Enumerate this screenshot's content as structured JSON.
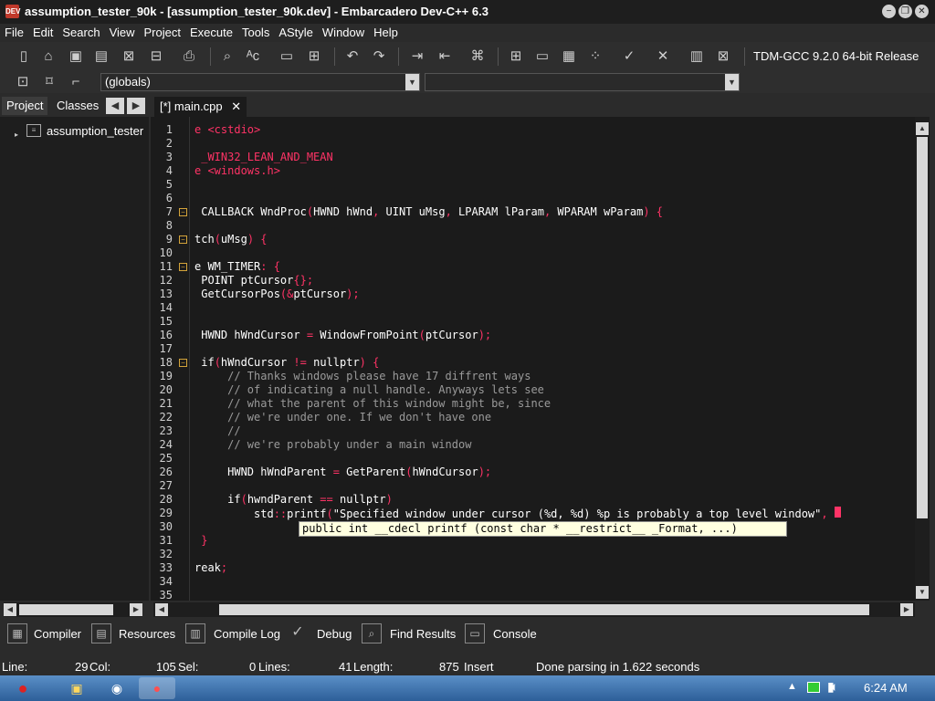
{
  "window": {
    "title": "assumption_tester_90k - [assumption_tester_90k.dev] - Embarcadero Dev-C++ 6.3",
    "app_icon_text": "DEV"
  },
  "menu": [
    "File",
    "Edit",
    "Search",
    "View",
    "Project",
    "Execute",
    "Tools",
    "AStyle",
    "Window",
    "Help"
  ],
  "toolbar": {
    "compiler_label": "TDM-GCC 9.2.0 64-bit Release",
    "scope_value": "(globals)"
  },
  "left_panel": {
    "tabs": [
      "Project",
      "Classes"
    ],
    "tree_item": "assumption_tester"
  },
  "editor": {
    "tab_label": "[*] main.cpp",
    "lines": [
      {
        "n": "1",
        "segs": [
          [
            "pp",
            "e <cstdio>"
          ]
        ]
      },
      {
        "n": "2",
        "segs": []
      },
      {
        "n": "3",
        "segs": [
          [
            "pp",
            " _WIN32_LEAN_AND_MEAN"
          ]
        ]
      },
      {
        "n": "4",
        "segs": [
          [
            "pp",
            "e <windows.h>"
          ]
        ]
      },
      {
        "n": "5",
        "segs": []
      },
      {
        "n": "6",
        "segs": []
      },
      {
        "n": "7",
        "segs": [
          [
            "kw",
            " CALLBACK WndProc"
          ],
          [
            "sym",
            "("
          ],
          [
            "kw",
            "HWND hWnd"
          ],
          [
            "sym",
            ", "
          ],
          [
            "kw",
            "UINT uMsg"
          ],
          [
            "sym",
            ", "
          ],
          [
            "kw",
            "LPARAM lParam"
          ],
          [
            "sym",
            ", "
          ],
          [
            "kw",
            "WPARAM wParam"
          ],
          [
            "sym",
            ") {"
          ]
        ]
      },
      {
        "n": "8",
        "segs": []
      },
      {
        "n": "9",
        "segs": [
          [
            "kw",
            "tch"
          ],
          [
            "sym",
            "("
          ],
          [
            "kw",
            "uMsg"
          ],
          [
            "sym",
            ") {"
          ]
        ]
      },
      {
        "n": "10",
        "segs": []
      },
      {
        "n": "11",
        "segs": [
          [
            "kw",
            "e WM_TIMER"
          ],
          [
            "sym",
            ": {"
          ]
        ]
      },
      {
        "n": "12",
        "segs": [
          [
            "kw",
            " POINT ptCursor"
          ],
          [
            "sym",
            "{};"
          ]
        ]
      },
      {
        "n": "13",
        "segs": [
          [
            "kw",
            " GetCursorPos"
          ],
          [
            "sym",
            "(&"
          ],
          [
            "kw",
            "ptCursor"
          ],
          [
            "sym",
            ");"
          ]
        ]
      },
      {
        "n": "14",
        "segs": []
      },
      {
        "n": "15",
        "segs": []
      },
      {
        "n": "16",
        "segs": [
          [
            "kw",
            " HWND hWndCursor "
          ],
          [
            "sym",
            "= "
          ],
          [
            "kw",
            "WindowFromPoint"
          ],
          [
            "sym",
            "("
          ],
          [
            "kw",
            "ptCursor"
          ],
          [
            "sym",
            ");"
          ]
        ]
      },
      {
        "n": "17",
        "segs": []
      },
      {
        "n": "18",
        "segs": [
          [
            "kw",
            " if"
          ],
          [
            "sym",
            "("
          ],
          [
            "kw",
            "hWndCursor "
          ],
          [
            "sym",
            "!= "
          ],
          [
            "kw",
            "nullptr"
          ],
          [
            "sym",
            ") {"
          ]
        ]
      },
      {
        "n": "19",
        "segs": [
          [
            "cm",
            "     // Thanks windows please have 17 diffrent ways"
          ]
        ]
      },
      {
        "n": "20",
        "segs": [
          [
            "cm",
            "     // of indicating a null handle. Anyways lets see"
          ]
        ]
      },
      {
        "n": "21",
        "segs": [
          [
            "cm",
            "     // what the parent of this window might be, since"
          ]
        ]
      },
      {
        "n": "22",
        "segs": [
          [
            "cm",
            "     // we're under one. If we don't have one"
          ]
        ]
      },
      {
        "n": "23",
        "segs": [
          [
            "cm",
            "     //"
          ]
        ]
      },
      {
        "n": "24",
        "segs": [
          [
            "cm",
            "     // we're probably under a main window"
          ]
        ]
      },
      {
        "n": "25",
        "segs": []
      },
      {
        "n": "26",
        "segs": [
          [
            "kw",
            "     HWND hWndParent "
          ],
          [
            "sym",
            "= "
          ],
          [
            "kw",
            "GetParent"
          ],
          [
            "sym",
            "("
          ],
          [
            "kw",
            "hWndCursor"
          ],
          [
            "sym",
            ");"
          ]
        ]
      },
      {
        "n": "27",
        "segs": []
      },
      {
        "n": "28",
        "segs": [
          [
            "kw",
            "     if"
          ],
          [
            "sym",
            "("
          ],
          [
            "kw",
            "hwndParent "
          ],
          [
            "sym",
            "== "
          ],
          [
            "kw",
            "nullptr"
          ],
          [
            "sym",
            ")"
          ]
        ]
      },
      {
        "n": "29",
        "segs": [
          [
            "kw",
            "         std"
          ],
          [
            "sym",
            "::"
          ],
          [
            "kw",
            "printf"
          ],
          [
            "sym",
            "("
          ],
          [
            "str",
            "\"Specified window under cursor (%d, %d) %p is probably a top level window\""
          ],
          [
            "sym",
            ", "
          ]
        ]
      },
      {
        "n": "30",
        "segs": []
      },
      {
        "n": "31",
        "segs": [
          [
            "sym",
            " }"
          ]
        ]
      },
      {
        "n": "32",
        "segs": []
      },
      {
        "n": "33",
        "segs": [
          [
            "kw",
            "reak"
          ],
          [
            "sym",
            ";"
          ]
        ]
      },
      {
        "n": "34",
        "segs": []
      },
      {
        "n": "35",
        "segs": []
      }
    ],
    "tooltip": "public int __cdecl printf (const char * __restrict__ _Format, ...)"
  },
  "bottom_tabs": [
    "Compiler",
    "Resources",
    "Compile Log",
    "Debug",
    "Find Results",
    "Console"
  ],
  "status": {
    "line_label": "Line:",
    "line_value": "29",
    "col_label": "Col:",
    "col_value": "105",
    "sel_label": "Sel:",
    "sel_value": "0",
    "lines_label": "Lines:",
    "lines_value": "41",
    "length_label": "Length:",
    "length_value": "875",
    "mode": "Insert",
    "message": "Done parsing in 1.622 seconds"
  },
  "taskbar": {
    "clock": "6:24 AM"
  }
}
